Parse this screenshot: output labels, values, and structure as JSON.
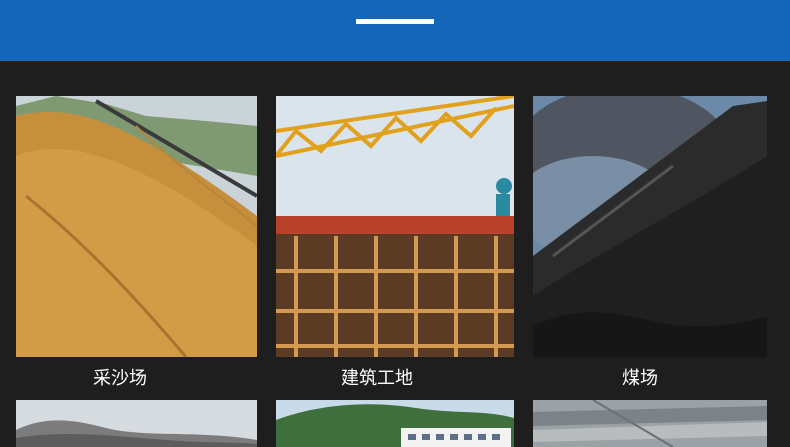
{
  "grid": {
    "items": [
      {
        "caption": "采沙场",
        "image": "sand-pile-photo"
      },
      {
        "caption": "建筑工地",
        "image": "construction-site-photo"
      },
      {
        "caption": "煤场",
        "image": "coal-yard-photo"
      },
      {
        "caption": "",
        "image": "rock-pile-photo"
      },
      {
        "caption": "",
        "image": "hillside-building-photo"
      },
      {
        "caption": "",
        "image": "quarry-photo"
      }
    ]
  },
  "colors": {
    "header": "#1466b8",
    "background": "#1e1e1e",
    "caption_text": "#ffffff"
  }
}
